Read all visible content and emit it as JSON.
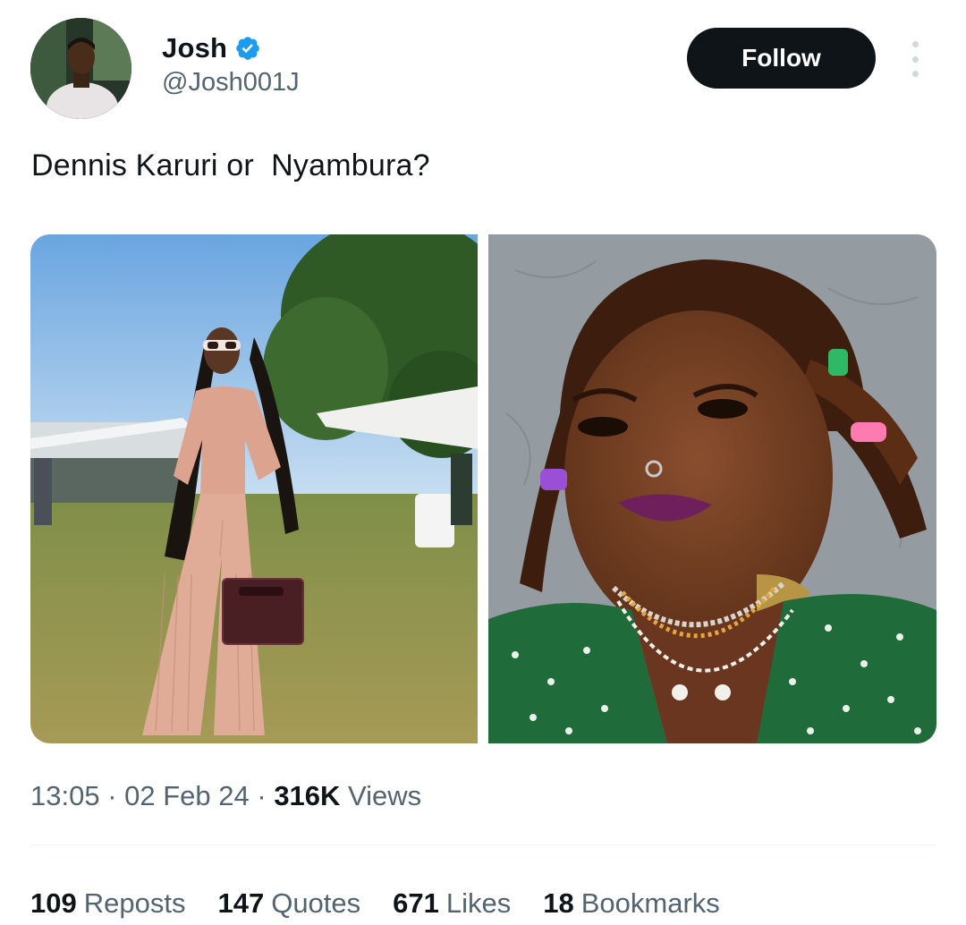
{
  "author": {
    "display_name": "Josh",
    "handle": "@Josh001J",
    "verified_icon": "verified-badge-icon"
  },
  "actions": {
    "follow_label": "Follow",
    "more_icon": "more-options-icon"
  },
  "tweet": {
    "text": "Dennis Karuri or  Nyambura?"
  },
  "meta": {
    "time": "13:05",
    "sep1": " · ",
    "date": "02 Feb 24",
    "sep2": " · ",
    "views_count": "316K",
    "views_label": " Views"
  },
  "stats": [
    {
      "count": "109",
      "label": "Reposts"
    },
    {
      "count": "147",
      "label": "Quotes"
    },
    {
      "count": "671",
      "label": "Likes"
    },
    {
      "count": "18",
      "label": "Bookmarks"
    }
  ],
  "colors": {
    "text_primary": "#0f1419",
    "text_secondary": "#536471",
    "verified_blue": "#1d9bf0",
    "follow_bg": "#0f1419"
  }
}
